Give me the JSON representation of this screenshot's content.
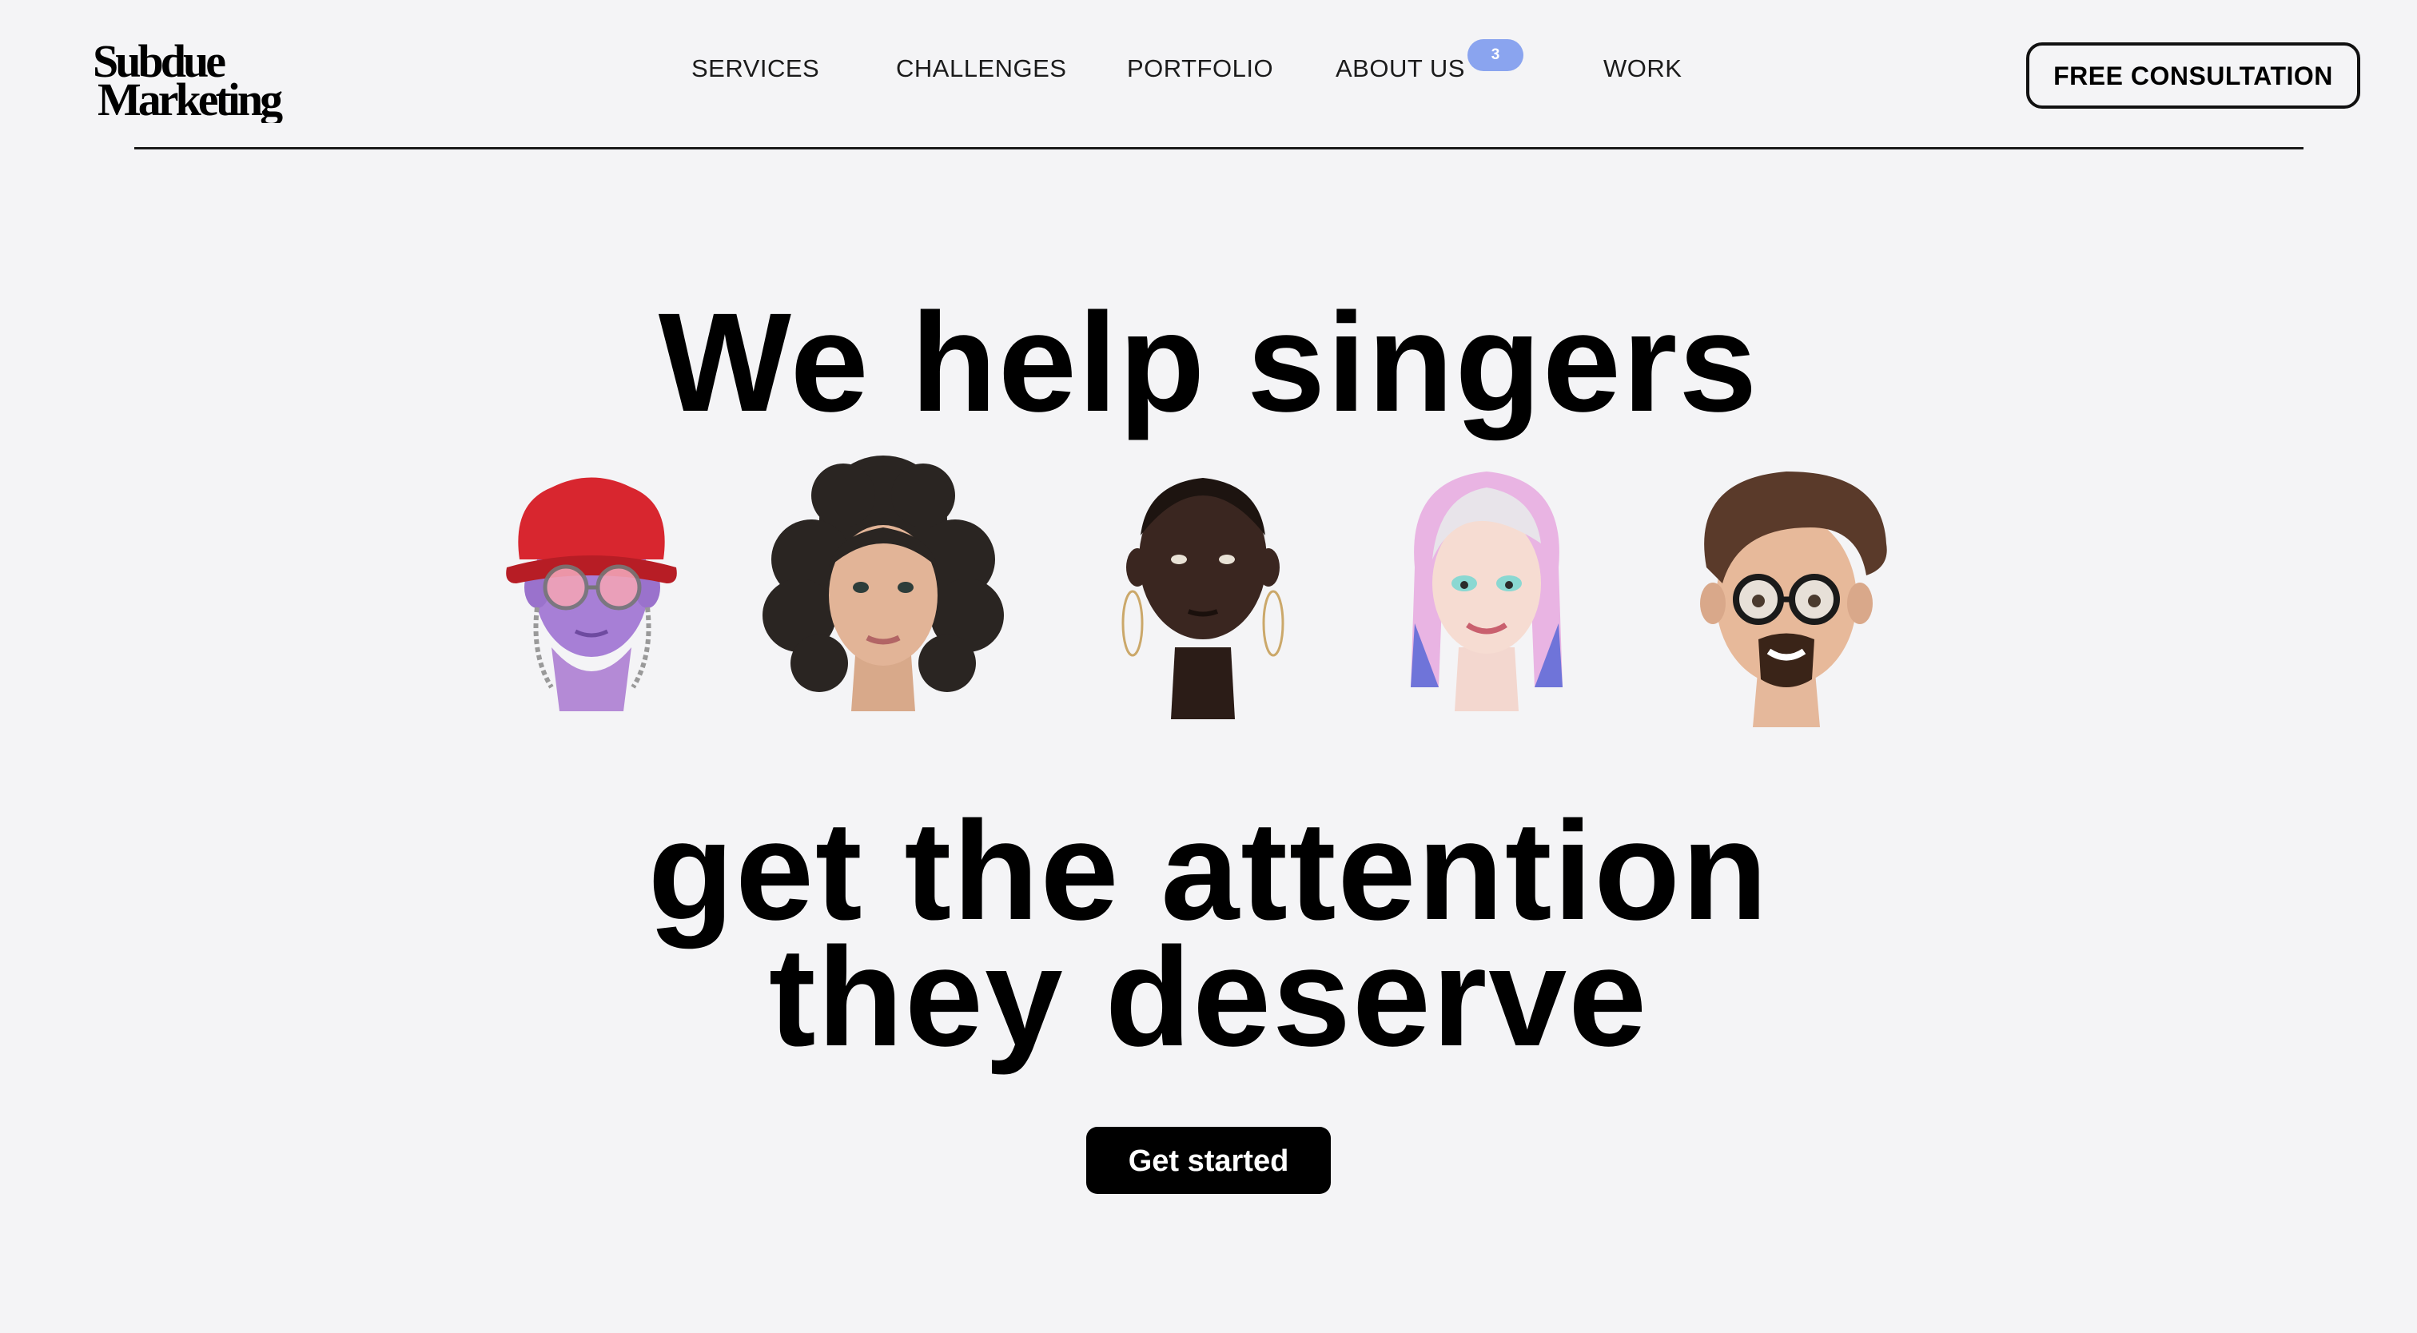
{
  "header": {
    "logo": {
      "line1": "Subdue",
      "line2": "Marketing"
    },
    "nav": [
      {
        "label": "SERVICES"
      },
      {
        "label": "CHALLENGES"
      },
      {
        "label": "PORTFOLIO"
      },
      {
        "label": "ABOUT US",
        "badge": "3"
      },
      {
        "label": "WORK"
      }
    ],
    "cta_label": "FREE CONSULTATION"
  },
  "hero": {
    "line1": "We help singers",
    "line2": "get the attention",
    "line3": "they deserve",
    "button_label": "Get started",
    "avatars": [
      {
        "icon": "avatar-red-bucket-hat-icon"
      },
      {
        "icon": "avatar-curly-hair-icon"
      },
      {
        "icon": "avatar-shaved-head-hoop-earrings-icon"
      },
      {
        "icon": "avatar-pastel-hair-icon"
      },
      {
        "icon": "avatar-glasses-beard-icon"
      }
    ]
  },
  "colors": {
    "background": "#f4f4f6",
    "text": "#000000",
    "badge": "#8aa4ef",
    "button_bg": "#000000",
    "button_text": "#ffffff"
  }
}
